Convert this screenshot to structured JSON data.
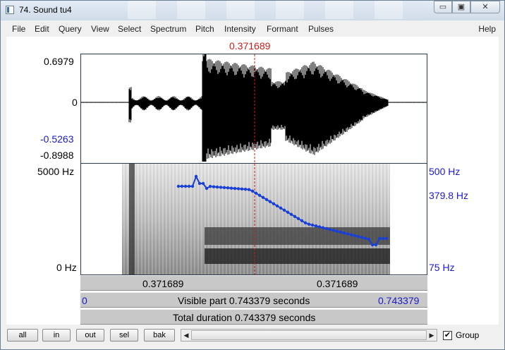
{
  "window": {
    "title": "74. Sound tu4",
    "controls": {
      "minimize": "▭",
      "restore": "▣",
      "close": "✕"
    }
  },
  "menu": {
    "items": [
      "File",
      "Edit",
      "Query",
      "View",
      "Select",
      "Spectrum",
      "Pitch",
      "Intensity",
      "Formant",
      "Pulses"
    ],
    "help": "Help"
  },
  "editor": {
    "cursor_time": "0.371689",
    "waveform": {
      "ymax": "0.6979",
      "zero": "0",
      "blue_value": "-0.5263",
      "ymin": "-0.8988"
    },
    "spectrogram": {
      "fmax": "5000 Hz",
      "fmin": "0 Hz",
      "pitch_max": "500 Hz",
      "pitch_value": "379.8 Hz",
      "pitch_min": "75 Hz"
    },
    "bars": {
      "left_segment": "0.371689",
      "right_segment": "0.371689",
      "visible_start": "0",
      "visible_text": "Visible part 0.743379 seconds",
      "visible_end": "0.743379",
      "total_text": "Total duration 0.743379 seconds"
    }
  },
  "bottom": {
    "buttons": [
      "all",
      "in",
      "out",
      "sel",
      "bak"
    ],
    "group_label": "Group",
    "group_checked": "✔"
  },
  "colors": {
    "cursor": "#d01a1a",
    "pitch": "#1a3fd6",
    "blue_label": "#1a1acc"
  }
}
